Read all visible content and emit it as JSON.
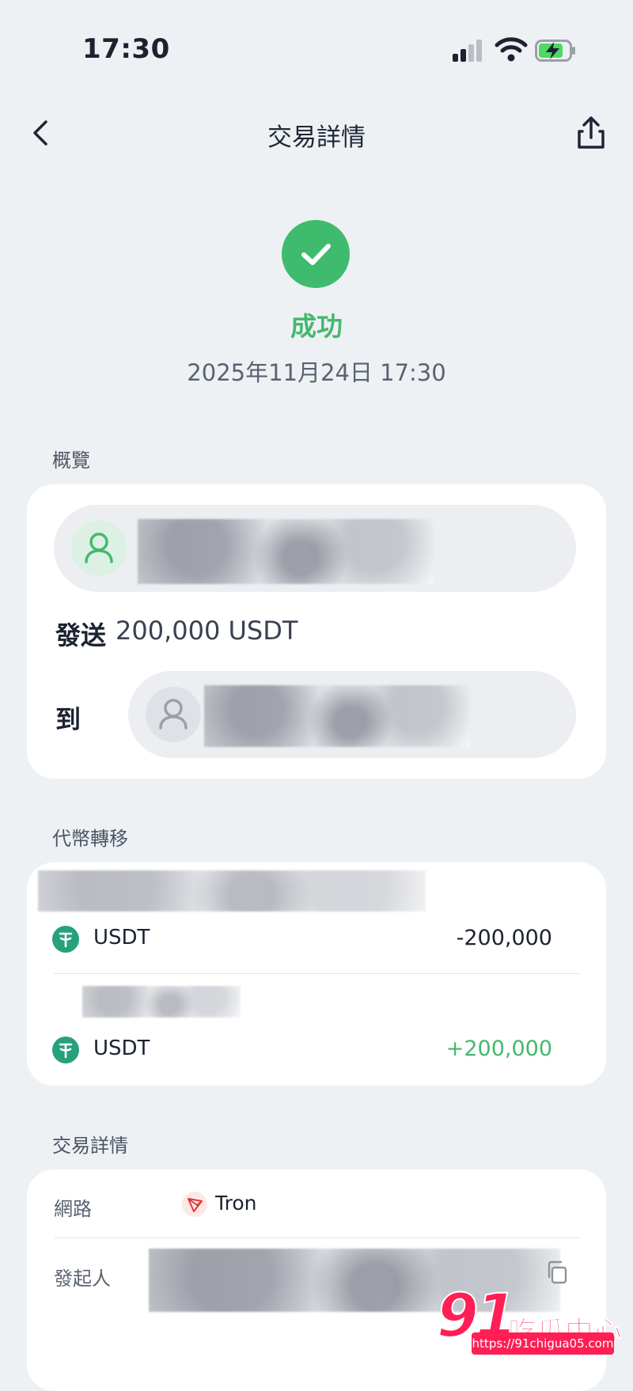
{
  "status_bar": {
    "time": "17:30"
  },
  "nav": {
    "title": "交易詳情"
  },
  "result": {
    "status": "成功",
    "datetime": "2025年11月24日 17:30"
  },
  "overview": {
    "section_title": "概覽",
    "send_label": "發送",
    "send_amount": "200,000 USDT",
    "to_label": "到"
  },
  "token_transfer": {
    "section_title": "代幣轉移",
    "rows": [
      {
        "token": "USDT",
        "amount": "-200,000",
        "color": "#1c2230"
      },
      {
        "token": "USDT",
        "amount": "+200,000",
        "color": "#46b86e"
      }
    ]
  },
  "details": {
    "section_title": "交易詳情",
    "network_label": "網路",
    "network_value": "Tron",
    "initiator_label": "發起人"
  },
  "watermark": {
    "number": "91",
    "text": "吃瓜中心",
    "url": "https://91chigua05.com"
  },
  "colors": {
    "success": "#3ebb6d",
    "background": "#eef1f4",
    "tether": "#26a17b",
    "tron": "#e0383e"
  }
}
